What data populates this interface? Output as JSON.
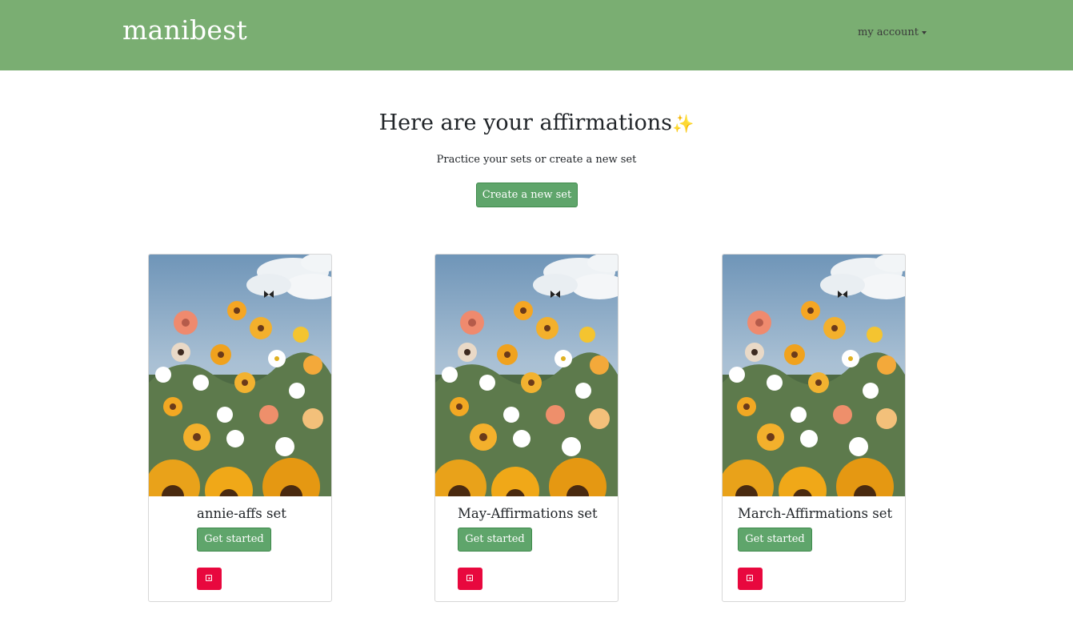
{
  "navbar": {
    "brand": "manibest",
    "account_label": "my account"
  },
  "hero": {
    "title": "Here are your affirmations",
    "sparkle": "✨",
    "subtitle": "Practice your sets or create a new set",
    "create_button": "Create a new set"
  },
  "sets": [
    {
      "name": "annie-affs set",
      "start_label": "Get started"
    },
    {
      "name": "May-Affirmations set",
      "start_label": "Get started"
    },
    {
      "name": "March-Affirmations set",
      "start_label": "Get started"
    }
  ],
  "colors": {
    "navbar": "#7aae72",
    "button_green": "#5fa56b",
    "delete_red": "#e8083e"
  }
}
